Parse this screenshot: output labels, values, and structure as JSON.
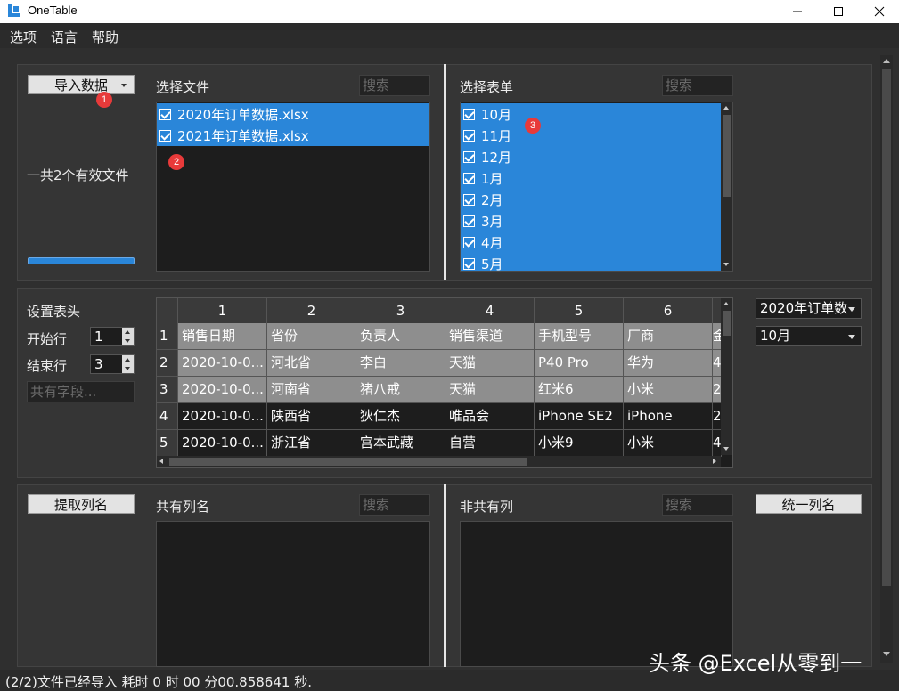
{
  "window": {
    "title": "OneTable"
  },
  "menu": {
    "options": "选项",
    "language": "语言",
    "help": "帮助"
  },
  "top": {
    "import_button": "导入数据",
    "file_count": "一共2个有效文件",
    "progress": 1.0,
    "files": {
      "label": "选择文件",
      "search_placeholder": "搜索",
      "items": [
        "2020年订单数据.xlsx",
        "2021年订单数据.xlsx"
      ]
    },
    "sheets": {
      "label": "选择表单",
      "search_placeholder": "搜索",
      "items": [
        "10月",
        "11月",
        "12月",
        "1月",
        "2月",
        "3月",
        "4月",
        "5月"
      ]
    },
    "badges": [
      "1",
      "2",
      "3"
    ]
  },
  "header": {
    "label": "设置表头",
    "start_row_label": "开始行",
    "start_row_value": "1",
    "end_row_label": "结束行",
    "end_row_value": "3",
    "fields_placeholder": "共有字段...",
    "file_combo": "2020年订单数",
    "sheet_combo": "10月",
    "table": {
      "col_headers": [
        "1",
        "2",
        "3",
        "4",
        "5",
        "6"
      ],
      "row_headers": [
        "1",
        "2",
        "3",
        "4",
        "5"
      ],
      "rows": [
        [
          "销售日期",
          "省份",
          "负责人",
          "销售渠道",
          "手机型号",
          "厂商",
          "金"
        ],
        [
          "2020-10-0...",
          "河北省",
          "李白",
          "天猫",
          "P40 Pro",
          "华为",
          "4"
        ],
        [
          "2020-10-0...",
          "河南省",
          "猪八戒",
          "天猫",
          "红米6",
          "小米",
          "2"
        ],
        [
          "2020-10-0...",
          "陕西省",
          "狄仁杰",
          "唯品会",
          "iPhone SE2",
          "iPhone",
          "2"
        ],
        [
          "2020-10-0...",
          "浙江省",
          "宫本武藏",
          "自营",
          "小米9",
          "小米",
          "4"
        ]
      ]
    }
  },
  "bottom": {
    "extract_button": "提取列名",
    "common": {
      "label": "共有列名",
      "search_placeholder": "搜索"
    },
    "noncommon": {
      "label": "非共有列",
      "search_placeholder": "搜索"
    },
    "unify_button": "统一列名"
  },
  "status": "(2/2)文件已经导入 耗时 0 时 00 分00.858641 秒.",
  "watermark": "头条 @Excel从零到一"
}
